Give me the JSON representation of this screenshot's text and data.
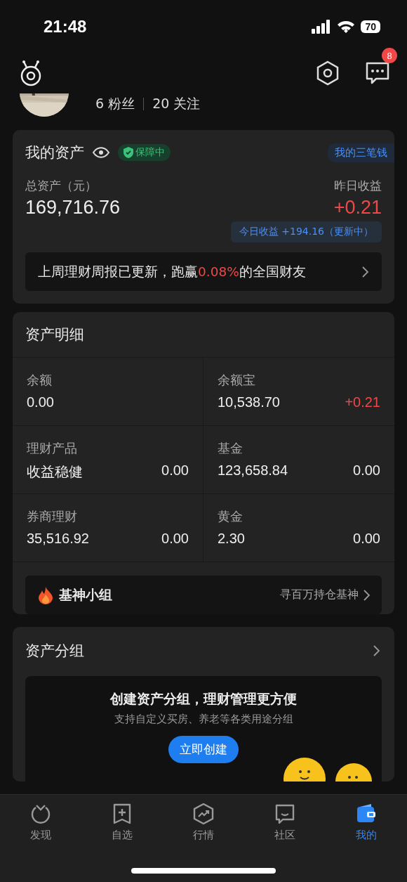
{
  "status_bar": {
    "time": "21:48",
    "battery": "70"
  },
  "header": {
    "message_badge": "8"
  },
  "profile": {
    "fans": "6 粉丝",
    "following": "20 关注"
  },
  "assets_card": {
    "title": "我的资产",
    "protection_badge": "保障中",
    "three_money_link": "我的三笔钱",
    "total_label": "总资产（元）",
    "total_value": "169,716.76",
    "yesterday_label": "昨日收益",
    "yesterday_value": "+0.21",
    "today_pill": "今日收益 +194.16（更新中）",
    "report_before": "上周理财周报已更新，跑赢",
    "report_highlight": "0.08%",
    "report_after": "的全国财友"
  },
  "details_card": {
    "title": "资产明细",
    "cells": [
      {
        "label": "余额",
        "value": "0.00"
      },
      {
        "label": "余额宝",
        "value": "10,538.70",
        "change": "+0.21",
        "color": "#f04848"
      },
      {
        "label": "理财产品",
        "value": "收益稳健",
        "change": "0.00",
        "color": "#eeeeee"
      },
      {
        "label": "基金",
        "value": "123,658.84",
        "change": "0.00",
        "color": "#eeeeee"
      },
      {
        "label": "券商理财",
        "value": "35,516.92",
        "change": "0.00",
        "color": "#eeeeee"
      },
      {
        "label": "黄金",
        "value": "2.30",
        "change": "0.00",
        "color": "#eeeeee"
      }
    ],
    "group_row": {
      "title": "基神小组",
      "hint": "寻百万持仓基神"
    }
  },
  "groups_card": {
    "title": "资产分组",
    "promo_title": "创建资产分组，理财管理更方便",
    "promo_subtitle": "支持自定义买房、养老等各类用途分组",
    "create_button": "立即创建"
  },
  "tab_bar": [
    {
      "label": "发现",
      "selected": false,
      "kind": "discover"
    },
    {
      "label": "自选",
      "selected": false,
      "kind": "watchlist"
    },
    {
      "label": "行情",
      "selected": false,
      "kind": "market"
    },
    {
      "label": "社区",
      "selected": false,
      "kind": "community"
    },
    {
      "label": "我的",
      "selected": true,
      "kind": "wallet"
    }
  ]
}
